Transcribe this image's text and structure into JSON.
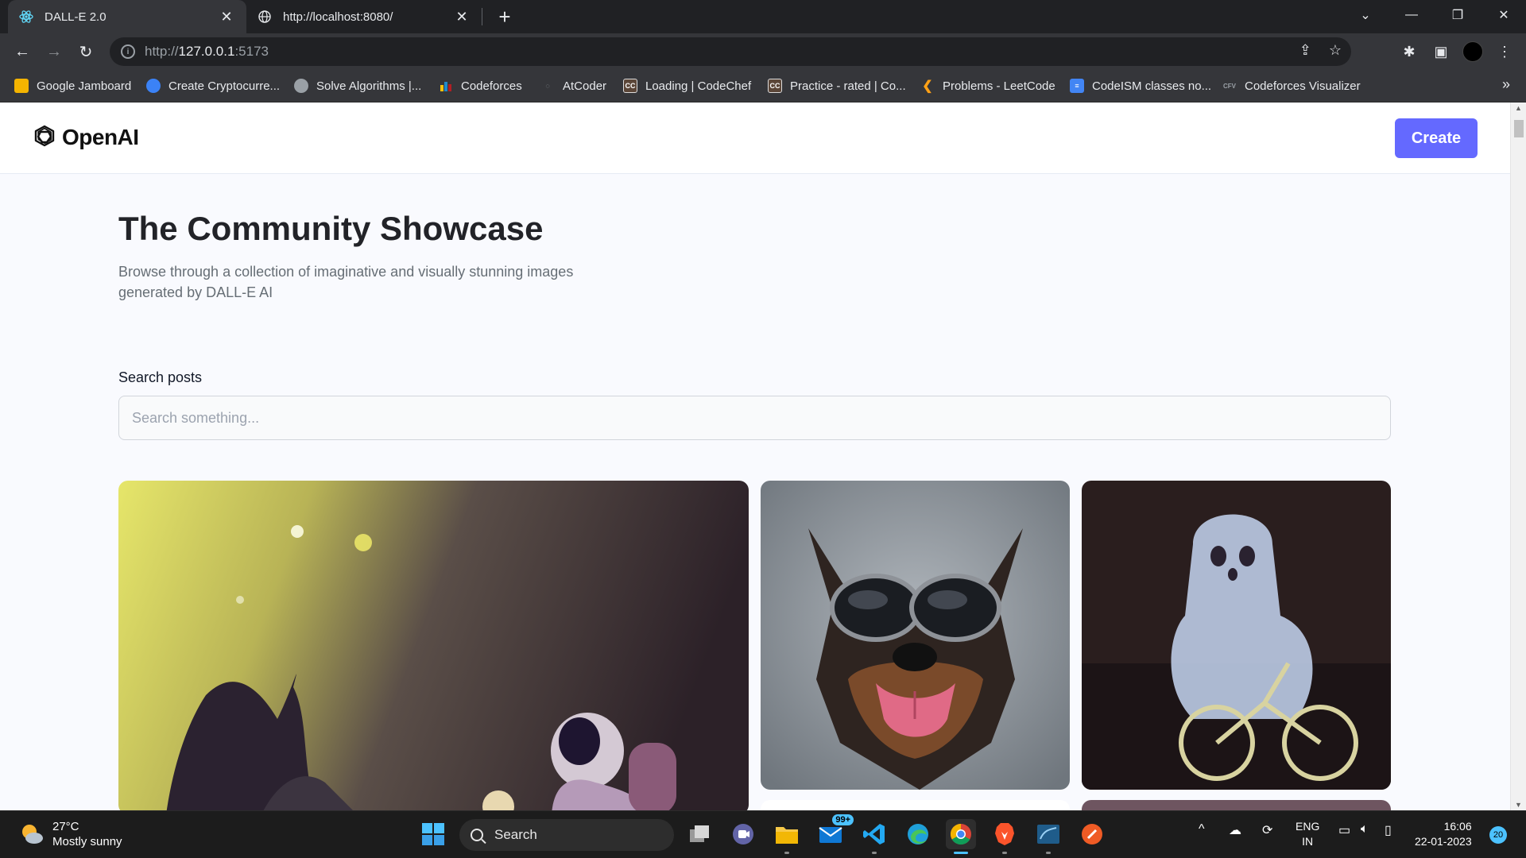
{
  "browser": {
    "tabs": [
      {
        "title": "DALL-E 2.0",
        "active": true
      },
      {
        "title": "http://localhost:8080/",
        "active": false
      }
    ],
    "url_prefix": "http://",
    "url_host": "127.0.0.1",
    "url_port": ":5173",
    "bookmarks": [
      {
        "label": "Google Jamboard",
        "icon": "jamboard-icon",
        "color": "#f4b400"
      },
      {
        "label": "Create Cryptocurre...",
        "icon": "crypto-icon",
        "color": "#3b82f6"
      },
      {
        "label": "Solve Algorithms |...",
        "icon": "globe-icon",
        "color": "#9aa0a6"
      },
      {
        "label": "Codeforces",
        "icon": "codeforces-icon",
        "color": "#1f8acb"
      },
      {
        "label": "AtCoder",
        "icon": "atcoder-icon",
        "color": "#555555"
      },
      {
        "label": "Loading | CodeChef",
        "icon": "codechef-icon",
        "color": "#5b4638"
      },
      {
        "label": "Practice - rated | Co...",
        "icon": "codechef-icon",
        "color": "#5b4638"
      },
      {
        "label": "Problems - LeetCode",
        "icon": "leetcode-icon",
        "color": "#ffa116"
      },
      {
        "label": "CodeISM classes no...",
        "icon": "docs-icon",
        "color": "#4285f4"
      },
      {
        "label": "Codeforces Visualizer",
        "icon": "cfv-icon",
        "color": "#777777"
      }
    ]
  },
  "site": {
    "logo_text": "OpenAI",
    "create_label": "Create",
    "hero_title": "The Community Showcase",
    "hero_subtitle": "Browse through a collection of imaginative and visually stunning images generated by DALL-E AI",
    "search_label": "Search posts",
    "search_placeholder": "Search something...",
    "cards": [
      {
        "subject": "astronaut-in-garden"
      },
      {
        "subject": "dog-with-sunglasses"
      },
      {
        "subject": "ghost-on-bicycle"
      }
    ]
  },
  "taskbar": {
    "weather_temp": "27°C",
    "weather_desc": "Mostly sunny",
    "search_label": "Search",
    "mail_badge": "99+",
    "lang_line1": "ENG",
    "lang_line2": "IN",
    "time": "16:06",
    "date": "22-01-2023",
    "notification_count": "20"
  },
  "colors": {
    "accent": "#6469ff",
    "page_bg": "#f9fafe",
    "title": "#222328",
    "subtitle": "#666e75"
  }
}
